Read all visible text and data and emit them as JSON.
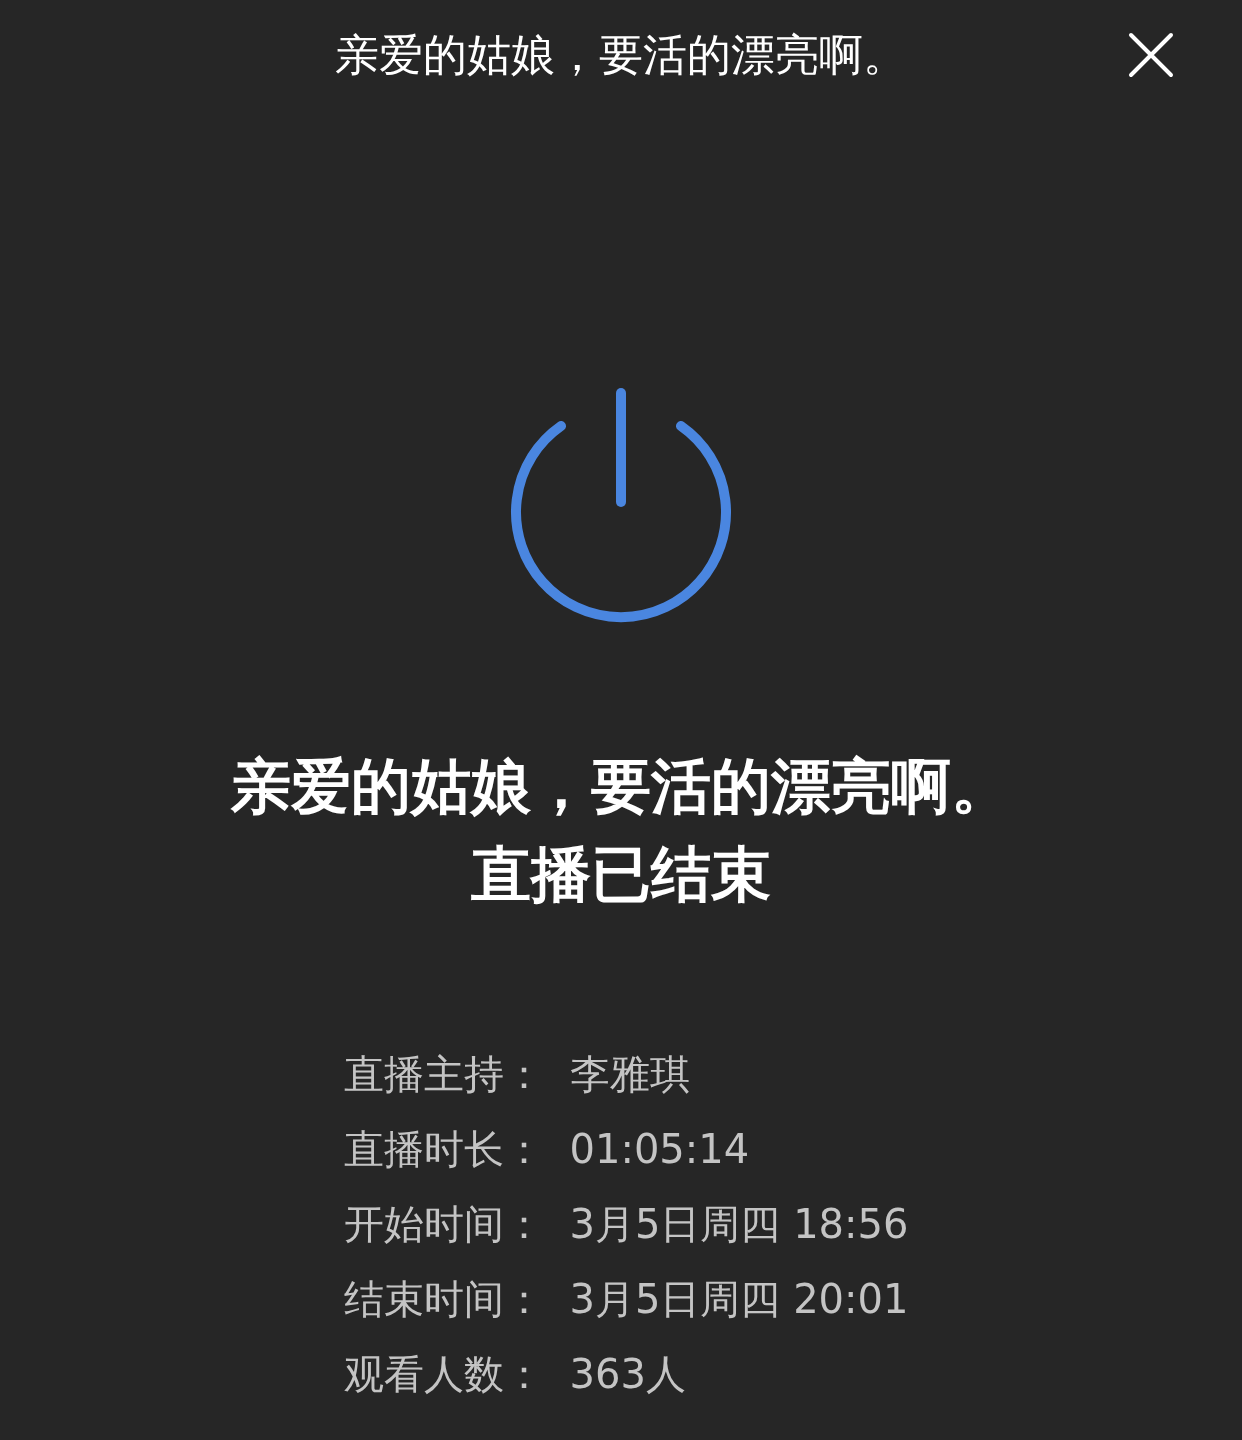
{
  "window": {
    "title": "亲爱的姑娘，要活的漂亮啊。"
  },
  "headline": "亲爱的姑娘，要活的漂亮啊。",
  "status": "直播已结束",
  "details": [
    {
      "label": "直播主持：",
      "value": "李雅琪"
    },
    {
      "label": "直播时长：",
      "value": "01:05:14"
    },
    {
      "label": "开始时间：",
      "value": "3月5日周四 18:56"
    },
    {
      "label": "结束时间：",
      "value": "3月5日周四 20:01"
    },
    {
      "label": "观看人数：",
      "value": "363人"
    }
  ]
}
